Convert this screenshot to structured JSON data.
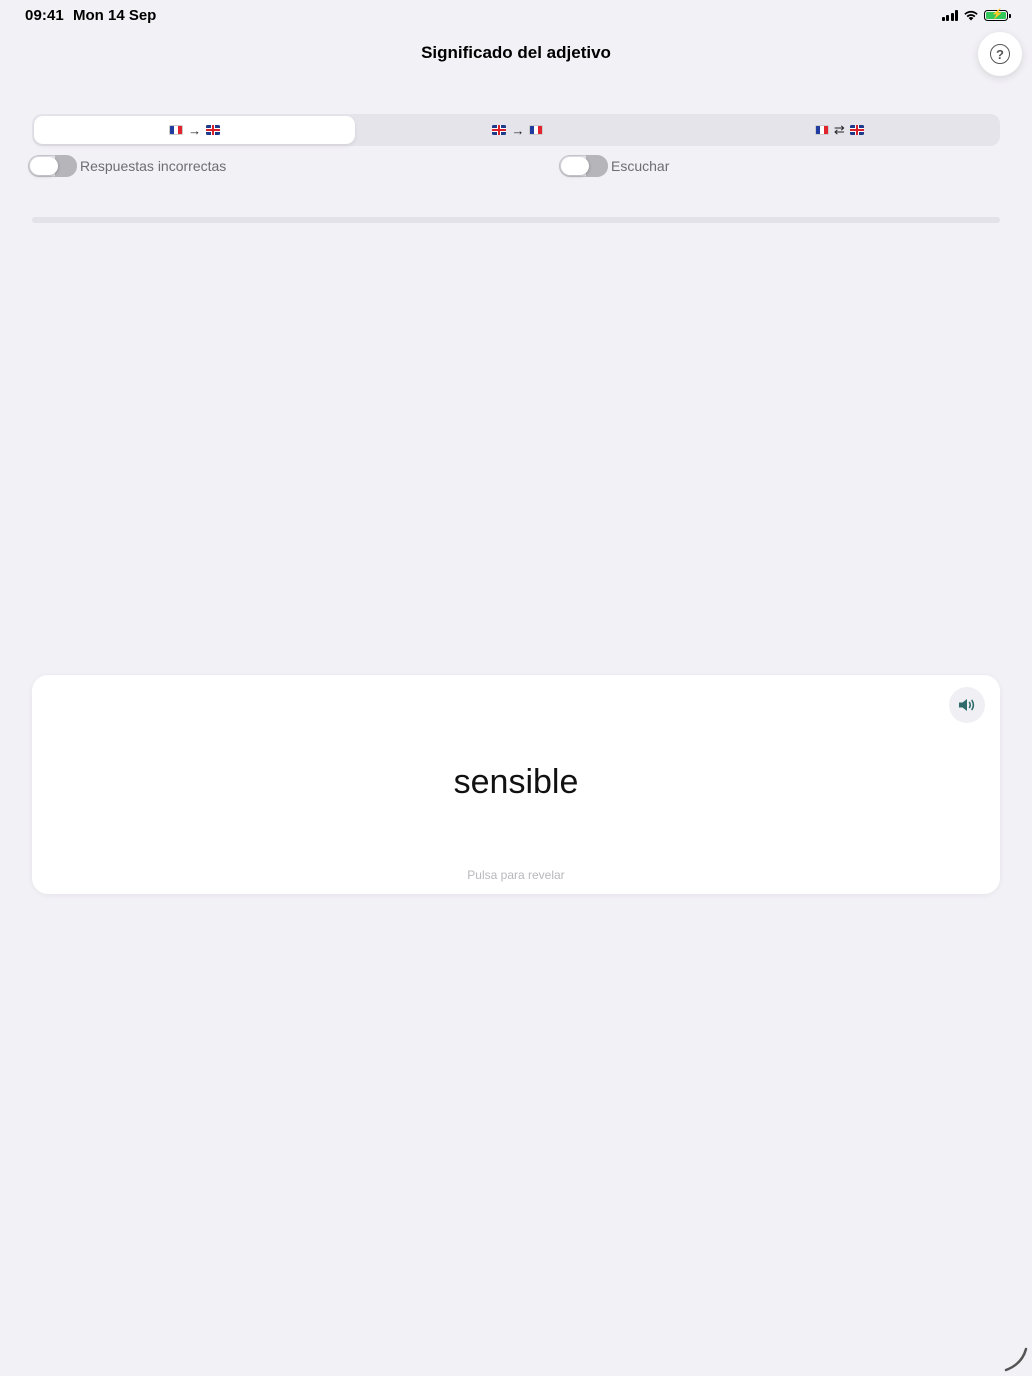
{
  "status_bar": {
    "time": "09:41",
    "date": "Mon 14 Sep",
    "battery_color": "#34c759"
  },
  "header": {
    "title": "Significado del adjetivo",
    "help_icon": "question-circle-icon",
    "help_glyph": "?"
  },
  "direction_tabs": [
    {
      "from": "fr-flag-icon",
      "arrow": "→",
      "to": "uk-flag-icon",
      "selected": true
    },
    {
      "from": "uk-flag-icon",
      "arrow": "→",
      "to": "fr-flag-icon",
      "selected": false
    },
    {
      "from": "fr-flag-icon",
      "arrow": "⇄",
      "to": "uk-flag-icon",
      "selected": false
    }
  ],
  "options": {
    "wrong_answers": {
      "label": "Respuestas incorrectas",
      "on": false
    },
    "listen": {
      "label": "Escuchar",
      "on": false
    }
  },
  "progress": {
    "fraction": 0
  },
  "card": {
    "word": "sensible",
    "hint": "Pulsa para revelar",
    "speaker_icon": "speaker-icon",
    "accent_color": "#2e6b6a"
  }
}
